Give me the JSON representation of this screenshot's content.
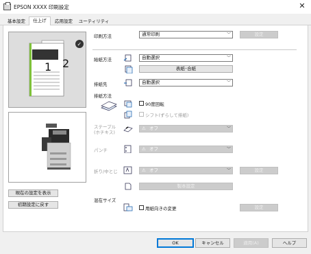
{
  "window": {
    "title": "EPSON XXXX 印刷設定",
    "close": "✕"
  },
  "tabs": [
    {
      "label": "基本設定"
    },
    {
      "label": "仕上げ"
    },
    {
      "label": "応用設定"
    },
    {
      "label": "ユーティリティー"
    }
  ],
  "preview": {
    "page_num_front": "1",
    "page_num_back": "2",
    "checkmark": "✓"
  },
  "left_buttons": {
    "show_current": "現在の設定を表示",
    "reset_defaults": "初期設定に戻す"
  },
  "print_method": {
    "label": "印刷方法",
    "value": "通常印刷",
    "settings_button": "設定"
  },
  "paper_source": {
    "label": "給紙方法",
    "value": "自動選択",
    "cover_button": "表紙･合紙"
  },
  "output_tray": {
    "label": "排紙先",
    "value": "自動選択"
  },
  "output_method": {
    "label": "排紙方法",
    "rotate_label": "90度回転",
    "shift_label": "シフト(ずらして排紙)"
  },
  "staple": {
    "label": "ステープル\n(ホチキス)",
    "value": "オフ"
  },
  "punch": {
    "label": "パンチ",
    "value": "オフ"
  },
  "fold": {
    "label": "折り/中とじ",
    "value": "オフ",
    "settings_button": "設定"
  },
  "booklet": {
    "button": "製本設定"
  },
  "mixed_size": {
    "label": "混在サイズ",
    "checkbox_label": "用紙向きの変更",
    "settings_button": "設定"
  },
  "footer": {
    "ok": "OK",
    "cancel": "キャンセル",
    "apply": "適用(A)",
    "help": "ヘルプ"
  },
  "colors": {
    "accent_green": "#7ec13a",
    "accent_blue": "#0078d7"
  }
}
